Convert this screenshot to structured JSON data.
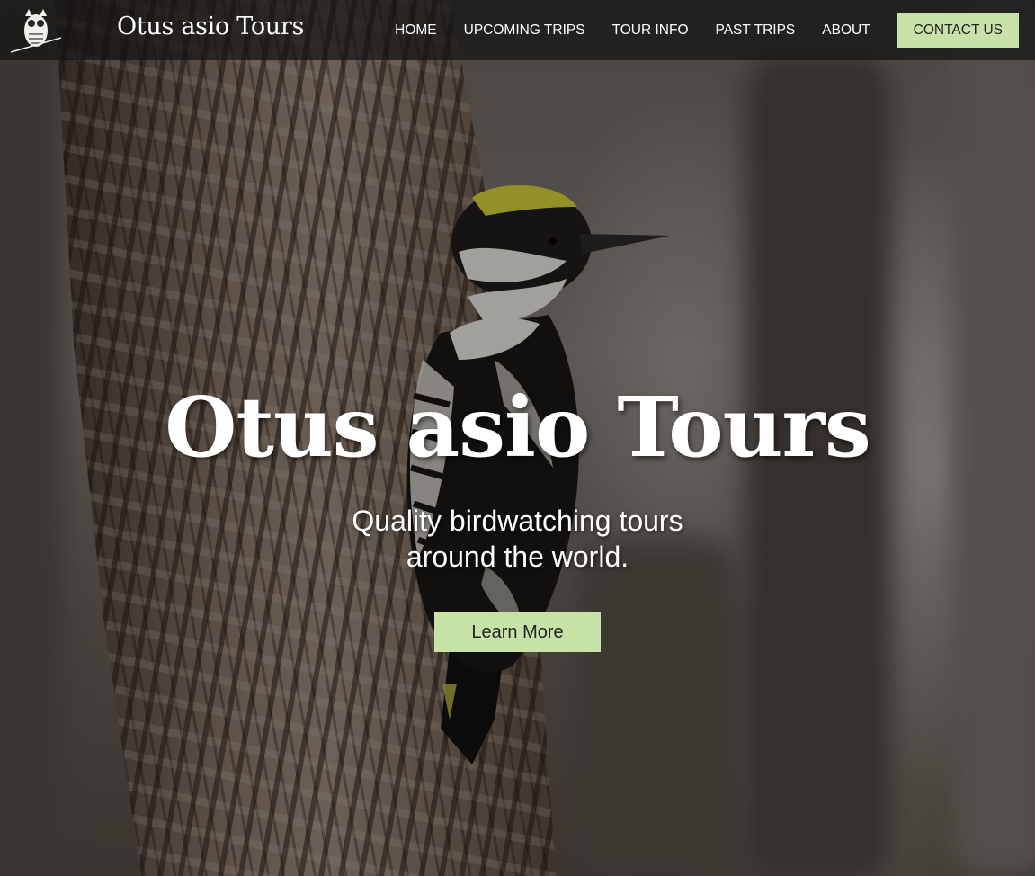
{
  "navbar": {
    "brand": "Otus asio Tours",
    "links": [
      "HOME",
      "UPCOMING TRIPS",
      "TOUR INFO",
      "PAST TRIPS",
      "ABOUT"
    ],
    "contact_label": "CONTACT US",
    "logo_icon": "owl-logo-icon"
  },
  "hero": {
    "title": "Otus asio Tours",
    "subtitle_line1": "Quality birdwatching tours",
    "subtitle_line2": "around the world.",
    "cta_label": "Learn More",
    "background_image": "woodpecker-on-tree-photo"
  },
  "colors": {
    "accent": "#c6e2a6",
    "nav_background": "#141414",
    "text": "#ffffff"
  }
}
